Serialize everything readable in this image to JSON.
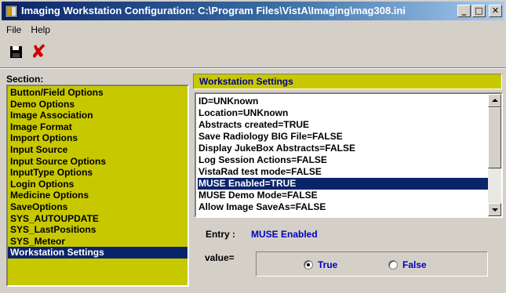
{
  "window": {
    "title": "Imaging Workstation Configuration:  C:\\Program Files\\VistA\\Imaging\\mag308.ini",
    "minimize_glyph": "_",
    "maximize_glyph": "□",
    "close_glyph": "✕"
  },
  "menu": {
    "file": "File",
    "help": "Help"
  },
  "toolbar": {
    "save_icon": "floppy-disk-icon",
    "cancel_icon": "red-x-icon",
    "cancel_glyph": "✘"
  },
  "section": {
    "label": "Section:",
    "items": [
      "Button/Field Options",
      "Demo Options",
      "Image Association",
      "Image Format",
      "Import Options",
      "Input Source",
      "Input Source Options",
      "InputType Options",
      "Login Options",
      "Medicine Options",
      "SaveOptions",
      "SYS_AUTOUPDATE",
      "SYS_LastPositions",
      "SYS_Meteor",
      "Workstation Settings"
    ],
    "selected_index": 14
  },
  "settings": {
    "header": "Workstation Settings",
    "items": [
      "ID=UNKnown",
      "Location=UNKnown",
      "Abstracts created=TRUE",
      "Save Radiology BIG File=FALSE",
      "Display JukeBox Abstracts=FALSE",
      "Log Session Actions=FALSE",
      "VistaRad test mode=FALSE",
      "MUSE Enabled=TRUE",
      "MUSE Demo Mode=FALSE",
      "Allow Image SaveAs=FALSE"
    ],
    "selected_index": 7
  },
  "entry": {
    "label": "Entry :",
    "value": "MUSE Enabled"
  },
  "value": {
    "label": "value=",
    "true_label": "True",
    "false_label": "False",
    "selected": "True"
  },
  "colors": {
    "panel_yellow": "#c8c800",
    "selection_navy": "#0a246a",
    "accent_blue": "#0000c0",
    "cancel_red": "#d40000"
  }
}
